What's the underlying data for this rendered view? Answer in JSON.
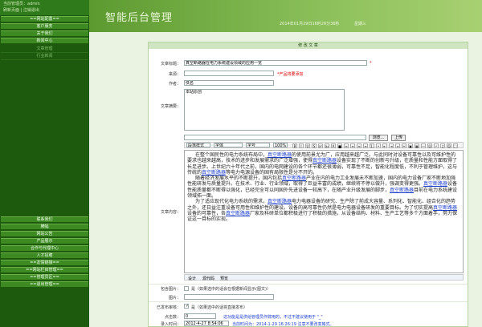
{
  "sidebar": {
    "user_line": "当前管理员：admin",
    "links_line": "刷新页面 | 注销退出",
    "top_groups": [
      {
        "label": "==网站配置=="
      },
      {
        "label": "客户服务"
      },
      {
        "label": "关于我们"
      },
      {
        "label": "新闻中心"
      }
    ],
    "sub_items": [
      {
        "label": "文章管理"
      },
      {
        "label": "行业新闻"
      }
    ],
    "bottom_groups": [
      {
        "label": "联系我们"
      },
      {
        "label": "横幅"
      },
      {
        "label": "网站公告"
      },
      {
        "label": "产品展示"
      },
      {
        "label": "合作与代理中心"
      },
      {
        "label": "人才招聘"
      },
      {
        "label": "==友情链接=="
      },
      {
        "label": "==网站栏目管理=="
      },
      {
        "label": "==管理员区=="
      },
      {
        "label": "==退出管理=="
      }
    ]
  },
  "header": {
    "title": "智能后台管理",
    "date": "2014年01月29日16时26分36秒",
    "weekday": "星期三"
  },
  "form": {
    "heading": "修 改 文 章",
    "labels": {
      "title": "文章标题：",
      "source": "来源：",
      "author": "作者：",
      "summary": "文章摘要：",
      "content": "文章内容：",
      "image": "包含图片：",
      "image_path": "图片：",
      "published": "已发布审核：",
      "hits": "点击数：",
      "entry_time": "录入时间："
    },
    "title_value": "真空断路器在电力系统建设领域的应用一览",
    "title_required": "*",
    "source_value": "",
    "source_hint": "*产品将要添加",
    "author_value": "佚名",
    "summary_value": "本站原创",
    "browse_button": "浏览...",
    "upload_button": "上传",
    "toolbar": {
      "paragraph_select": "段落样式",
      "font_select": "字体",
      "size_select": "字号",
      "zoom_select": "100%"
    },
    "content_paragraphs": [
      "在整个国民性的电力系统布局中，真空断路器的使用前景尤为广，应用越来越广泛。与此同时对设备可靠性以及可维护性的要求也越来越高，技术的进步和发展需求的广泛增强，使得真空断路器设备实现了不断的创新与升级，在质量和性能方面取得了长足进步。上世纪六十年代之前，国内的电网建设的各个环节都还很薄弱，可靠性不足，智能化程度低，不利于管理维护，这与传统的真空断路器等电力电源设备的固有局限性是分不开的。",
      "随着经济发展水平的不断提升，国内包括真空断路器产业在内的电力工业发展未不断加速，国内的电力设备厂家不断地加强性能研发与质量提升。在技术、行业、行业领域，取得了巨益丰富的成绩，继续将不停以做升，强调变得更强。真空断路器设备性能质量都不断得以强化，已经完全可以同国外先进设备一较高下，在随产业升级发展的脚步，真空断路器目前在电力系统建设领域拓一面。",
      "为了适应现代化电力系统的需求，真空断路器电力电器设备的研究、生产除了前成大容量、系列化、智能化、组合化的趋势之外，还日益注重设备可用性和维护性的建设。设备的高可靠性仍然是电力电器设备研发的重要目标。为了切实提高真空断路器设备的可靠性，各真空断路器厂家及科研单位都积极进行了积极的措施，从设备结构、材料、生产工艺等多个方面着手，努力保证这一目标的实现。"
    ],
    "editor_tabs": {
      "design": "设计",
      "html": "源代码",
      "preview": "预览"
    },
    "image_checkbox_label": "是（如果选中的话会在根据新闻显示(图文)）",
    "image_path_value": "",
    "published_checkbox_label": "是（如果选中的话将直接发布）",
    "hits_value": "0",
    "hits_hint": "这功能是是供给管理员作弊用的，不过不建议使用于 \"_\"",
    "entry_time_value": "2012-4-27 8:54:06",
    "entry_time_hint": "当前时间为：2014-1-29 16:26:19 注意不要改变格式。"
  }
}
